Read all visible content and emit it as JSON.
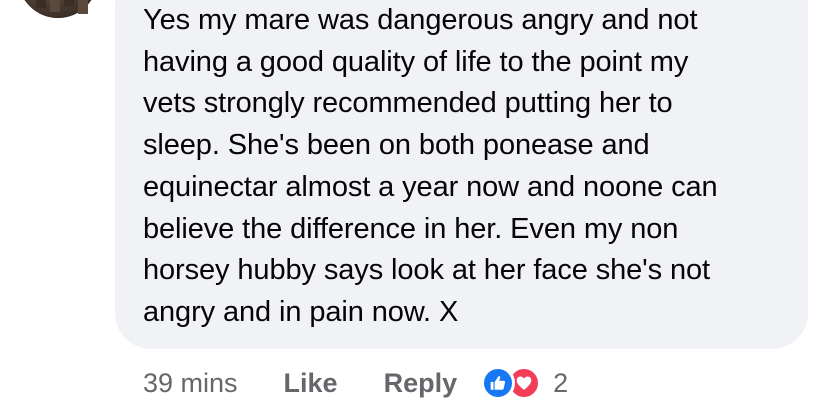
{
  "comment": {
    "lines": [
      "Yes my mare was dangerous angry and not",
      "having a good quality of life to the point my",
      "vets strongly recommended putting her to",
      "sleep. She's been on both ponease and",
      "equinectar almost a year now and noone can",
      "believe the difference in her. Even my non",
      "horsey hubby says look at her face she's not",
      "angry and in pain now. X"
    ],
    "bubble_color": "#f0f2f5",
    "text_color": "#050505"
  },
  "actions": {
    "timestamp": "39 mins",
    "like_label": "Like",
    "reply_label": "Reply",
    "reaction_count": "2",
    "reactions": [
      "like-icon",
      "love-icon"
    ],
    "like_color": "#1877f2",
    "love_color": "#f33e58",
    "muted_color": "#65676b"
  },
  "author": {
    "avatar": "avatar-photo"
  }
}
